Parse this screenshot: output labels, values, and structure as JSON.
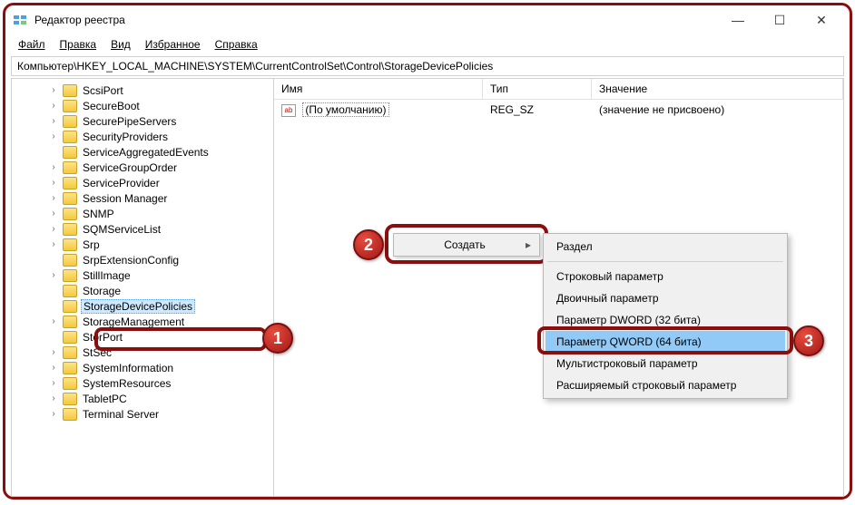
{
  "window": {
    "title": "Редактор реестра",
    "minimize": "—",
    "maximize": "☐",
    "close": "✕"
  },
  "menu": {
    "file": "Файл",
    "edit": "Правка",
    "view": "Вид",
    "favorites": "Избранное",
    "help": "Справка"
  },
  "address": "Компьютер\\HKEY_LOCAL_MACHINE\\SYSTEM\\CurrentControlSet\\Control\\StorageDevicePolicies",
  "tree": {
    "items": [
      "ScsiPort",
      "SecureBoot",
      "SecurePipeServers",
      "SecurityProviders",
      "ServiceAggregatedEvents",
      "ServiceGroupOrder",
      "ServiceProvider",
      "Session Manager",
      "SNMP",
      "SQMServiceList",
      "Srp",
      "SrpExtensionConfig",
      "StillImage",
      "Storage",
      "StorageDevicePolicies",
      "StorageManagement",
      "StorPort",
      "StSec",
      "SystemInformation",
      "SystemResources",
      "TabletPC",
      "Terminal Server"
    ],
    "selected_index": 14,
    "expandable": [
      0,
      1,
      2,
      3,
      5,
      6,
      7,
      8,
      9,
      10,
      12,
      15,
      17,
      18,
      19,
      20,
      21
    ]
  },
  "list": {
    "columns": {
      "name": "Имя",
      "type": "Тип",
      "value": "Значение"
    },
    "rows": [
      {
        "icon": "ab",
        "name": "(По умолчанию)",
        "type": "REG_SZ",
        "value": "(значение не присвоено)"
      }
    ]
  },
  "context_menu": {
    "create": "Создать",
    "arrow": "▸",
    "submenu": {
      "key": "Раздел",
      "string": "Строковый параметр",
      "binary": "Двоичный параметр",
      "dword": "Параметр DWORD (32 бита)",
      "qword": "Параметр QWORD (64 бита)",
      "multi": "Мультистроковый параметр",
      "expand": "Расширяемый строковый параметр"
    }
  },
  "badges": {
    "1": "1",
    "2": "2",
    "3": "3"
  }
}
